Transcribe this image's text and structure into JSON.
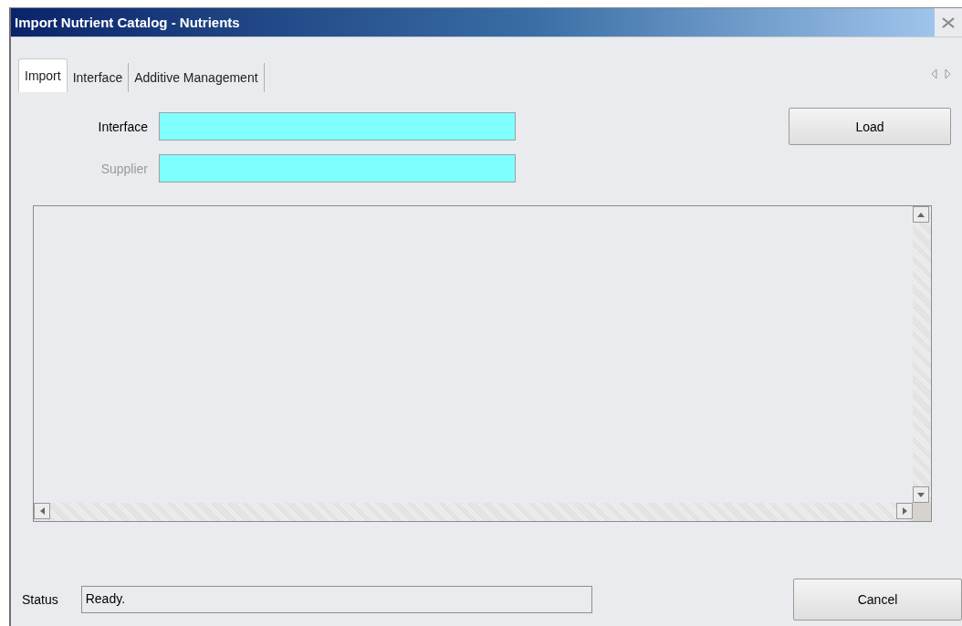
{
  "window": {
    "title": "Import Nutrient Catalog - Nutrients"
  },
  "tabs": [
    {
      "label": "Import",
      "selected": true
    },
    {
      "label": "Interface",
      "selected": false
    },
    {
      "label": "Additive Management",
      "selected": false
    }
  ],
  "fields": [
    {
      "label": "Interface",
      "disabled": false
    },
    {
      "label": "Supplier",
      "disabled": true
    }
  ],
  "load_button": "Load",
  "status": {
    "label": "Status",
    "value": "Ready."
  },
  "cancel_button": "Cancel"
}
